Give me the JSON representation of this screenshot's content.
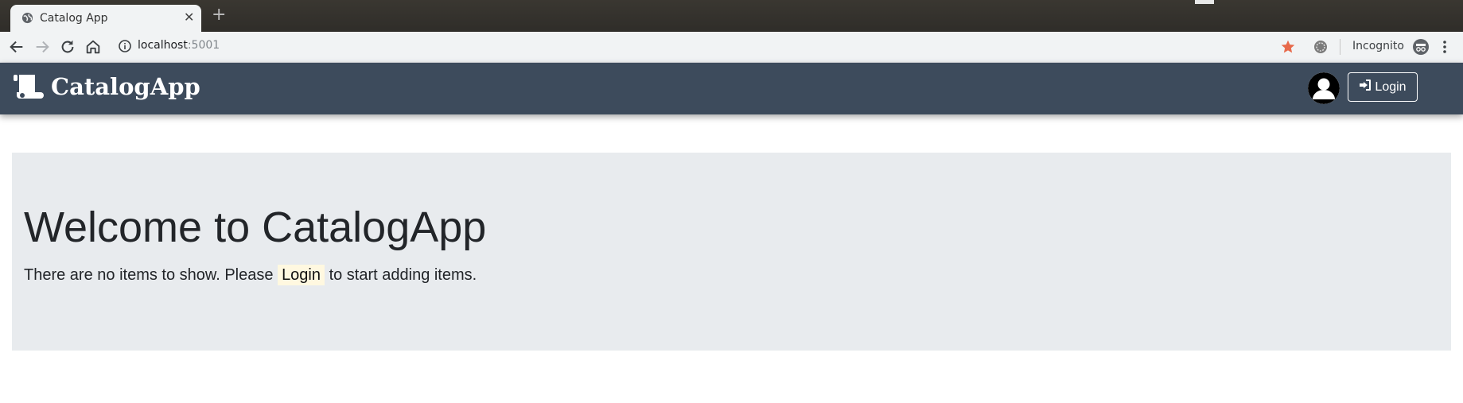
{
  "browser": {
    "tab_title": "Catalog App",
    "tab_close": "✕",
    "new_tab": "+",
    "url_host": "localhost",
    "url_port": ":5001",
    "profile_label": "Incognito"
  },
  "navbar": {
    "brand": "CatalogApp",
    "login_label": "Login",
    "background_color": "#3d4b5c"
  },
  "jumbotron": {
    "heading": "Welcome to CatalogApp",
    "message_before": "There are no items to show. Please",
    "message_link": "Login",
    "message_after": "to start adding items.",
    "background_color": "#e8ebee"
  },
  "icons": {
    "back": "arrow-left-icon",
    "forward": "arrow-right-icon",
    "reload": "reload-icon",
    "home": "home-icon",
    "site_info": "info-icon",
    "bookmark": "star-icon",
    "extension": "extension-icon",
    "incognito": "incognito-icon",
    "menu": "kebab-menu-icon",
    "brand": "scroll-icon",
    "user": "user-avatar-icon",
    "login": "sign-in-icon"
  }
}
